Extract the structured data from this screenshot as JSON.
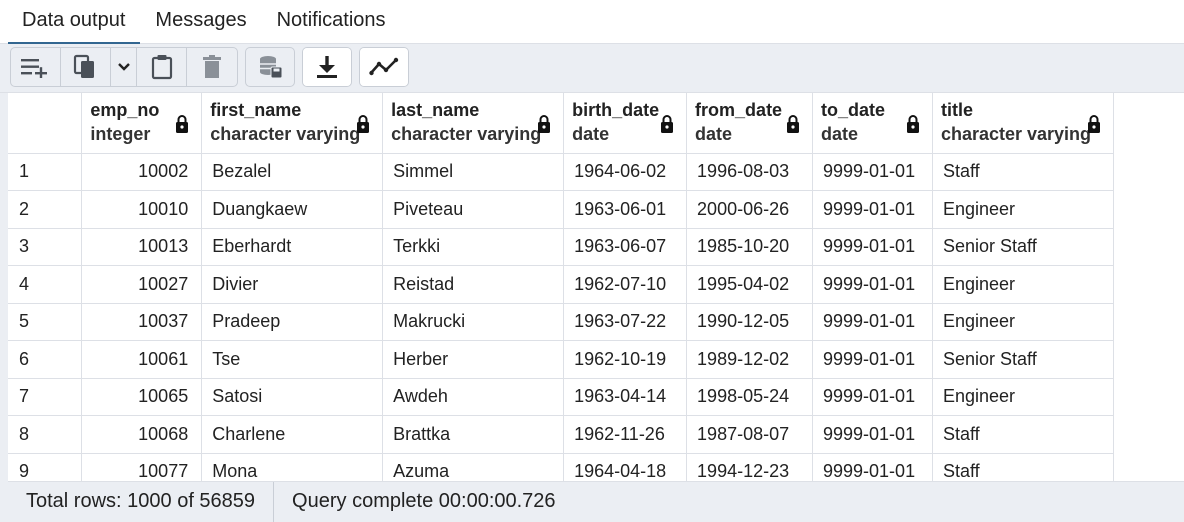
{
  "tabs": [
    {
      "label": "Data output",
      "active": true
    },
    {
      "label": "Messages",
      "active": false
    },
    {
      "label": "Notifications",
      "active": false
    }
  ],
  "toolbar": {
    "buttons": [
      "add-row-icon",
      "copy-icon",
      "chevron-down-icon",
      "paste-icon",
      "delete-icon",
      "save-data-icon",
      "download-icon",
      "graph-icon"
    ]
  },
  "grid": {
    "columns": [
      {
        "name": "emp_no",
        "type": "integer"
      },
      {
        "name": "first_name",
        "type": "character varying"
      },
      {
        "name": "last_name",
        "type": "character varying"
      },
      {
        "name": "birth_date",
        "type": "date"
      },
      {
        "name": "from_date",
        "type": "date"
      },
      {
        "name": "to_date",
        "type": "date"
      },
      {
        "name": "title",
        "type": "character varying"
      }
    ],
    "rows": [
      [
        "1",
        "10002",
        "Bezalel",
        "Simmel",
        "1964-06-02",
        "1996-08-03",
        "9999-01-01",
        "Staff"
      ],
      [
        "2",
        "10010",
        "Duangkaew",
        "Piveteau",
        "1963-06-01",
        "2000-06-26",
        "9999-01-01",
        "Engineer"
      ],
      [
        "3",
        "10013",
        "Eberhardt",
        "Terkki",
        "1963-06-07",
        "1985-10-20",
        "9999-01-01",
        "Senior Staff"
      ],
      [
        "4",
        "10027",
        "Divier",
        "Reistad",
        "1962-07-10",
        "1995-04-02",
        "9999-01-01",
        "Engineer"
      ],
      [
        "5",
        "10037",
        "Pradeep",
        "Makrucki",
        "1963-07-22",
        "1990-12-05",
        "9999-01-01",
        "Engineer"
      ],
      [
        "6",
        "10061",
        "Tse",
        "Herber",
        "1962-10-19",
        "1989-12-02",
        "9999-01-01",
        "Senior Staff"
      ],
      [
        "7",
        "10065",
        "Satosi",
        "Awdeh",
        "1963-04-14",
        "1998-05-24",
        "9999-01-01",
        "Engineer"
      ],
      [
        "8",
        "10068",
        "Charlene",
        "Brattka",
        "1962-11-26",
        "1987-08-07",
        "9999-01-01",
        "Staff"
      ],
      [
        "9",
        "10077",
        "Mona",
        "Azuma",
        "1964-04-18",
        "1994-12-23",
        "9999-01-01",
        "Staff"
      ]
    ]
  },
  "status": {
    "total_rows": "Total rows: 1000 of 56859",
    "query": "Query complete 00:00:00.726"
  },
  "colors": {
    "accent": "#326690",
    "toolbar_bg": "#ebeef3",
    "border": "#dde0e6"
  }
}
